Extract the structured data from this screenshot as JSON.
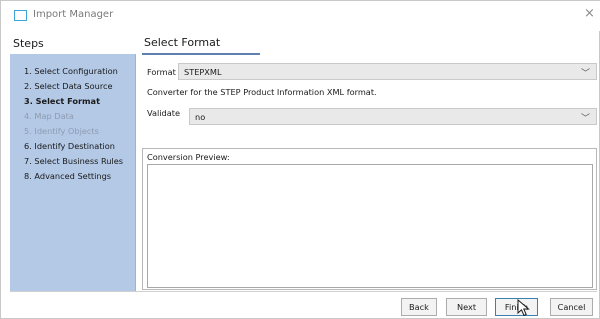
{
  "window": {
    "title": "Import Manager",
    "close_glyph": "×"
  },
  "sidebar": {
    "header": "Steps",
    "items": [
      {
        "label": "1. Select Configuration",
        "state": "normal"
      },
      {
        "label": "2. Select Data Source",
        "state": "normal"
      },
      {
        "label": "3. Select Format",
        "state": "active"
      },
      {
        "label": "4. Map Data",
        "state": "disabled"
      },
      {
        "label": "5. Identify Objects",
        "state": "disabled"
      },
      {
        "label": "6. Identify Destination",
        "state": "normal"
      },
      {
        "label": "7. Select Business Rules",
        "state": "normal"
      },
      {
        "label": "8. Advanced Settings",
        "state": "normal"
      }
    ],
    "panel_color": "#b3c9e6"
  },
  "main": {
    "title": "Select Format",
    "format": {
      "label": "Format",
      "value": "STEPXML",
      "description": "Converter for the STEP Product Information XML format."
    },
    "validate": {
      "label": "Validate",
      "value": "no"
    },
    "preview": {
      "label": "Conversion Preview:"
    }
  },
  "buttons": {
    "back": "Back",
    "next": "Next",
    "finish": "Finish",
    "cancel": "Cancel"
  },
  "icons": {
    "app": "window-icon",
    "dropdown": "chevron-down-icon",
    "cursor": "mouse-pointer-icon"
  }
}
